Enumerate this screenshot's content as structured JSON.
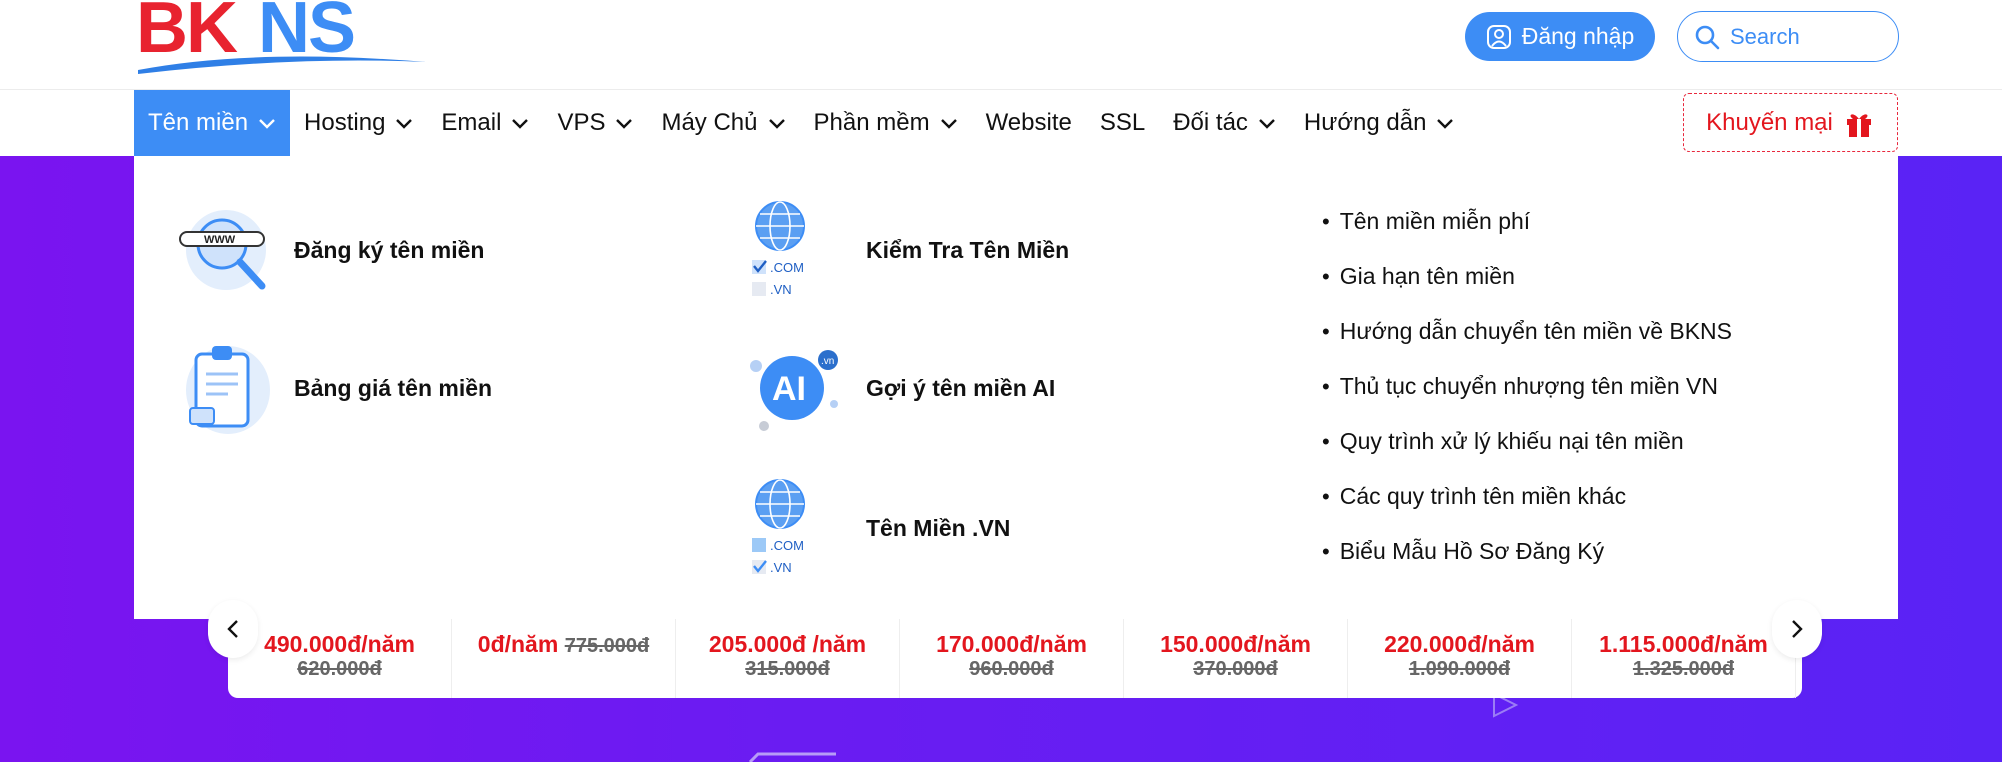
{
  "header": {
    "logo_text": "BKNS",
    "login_label": "Đăng nhập",
    "search_placeholder": "Search"
  },
  "nav": {
    "items": [
      {
        "label": "Tên miền",
        "dropdown": true,
        "active": true
      },
      {
        "label": "Hosting",
        "dropdown": true
      },
      {
        "label": "Email",
        "dropdown": true
      },
      {
        "label": "VPS",
        "dropdown": true
      },
      {
        "label": "Máy Chủ",
        "dropdown": true
      },
      {
        "label": "Phần mềm",
        "dropdown": true
      },
      {
        "label": "Website",
        "dropdown": false
      },
      {
        "label": "SSL",
        "dropdown": false
      },
      {
        "label": "Đối tác",
        "dropdown": true
      },
      {
        "label": "Hướng dẫn",
        "dropdown": true
      }
    ],
    "promo_label": "Khuyến mại"
  },
  "dropdown": {
    "cards": [
      {
        "label": "Đăng ký tên miền",
        "icon": "domain-search-icon"
      },
      {
        "label": "Kiểm Tra Tên Miền",
        "icon": "globe-checkbox-icon",
        "tags": [
          ".COM",
          ".VN"
        ]
      },
      {
        "label": "Bảng giá tên miền",
        "icon": "price-clipboard-icon"
      },
      {
        "label": "Gợi ý tên miền AI",
        "icon": "ai-badge-icon",
        "badge": "AI",
        "tag": ".vn"
      },
      {
        "label": "Tên Miền .VN",
        "icon": "globe-vn-icon",
        "tags": [
          ".COM",
          ".VN"
        ]
      }
    ],
    "links": [
      "Tên miền miễn phí",
      "Gia hạn tên miền",
      "Hướng dẫn chuyển tên miền về BKNS",
      "Thủ tục chuyển nhượng tên miền VN",
      "Quy trình xử lý khiếu nại tên miền",
      "Các quy trình tên miền khác",
      "Biểu Mẫu Hồ Sơ Đăng Ký"
    ]
  },
  "prices": [
    {
      "now": "490.000đ/năm",
      "old": "620.000đ"
    },
    {
      "now": "0đ/năm",
      "old": "775.000đ",
      "inline": true
    },
    {
      "now": "205.000đ /năm",
      "old": "315.000đ"
    },
    {
      "now": "170.000đ/năm",
      "old": "960.000đ"
    },
    {
      "now": "150.000đ/năm",
      "old": "370.000đ"
    },
    {
      "now": "220.000đ/năm",
      "old": "1.090.000đ"
    },
    {
      "now": "1.115.000đ/năm",
      "old": "1.325.000đ"
    }
  ],
  "colors": {
    "brand_blue": "#3d8df5",
    "brand_red": "#e3161e",
    "hero_purple": "#6a1cf2"
  }
}
